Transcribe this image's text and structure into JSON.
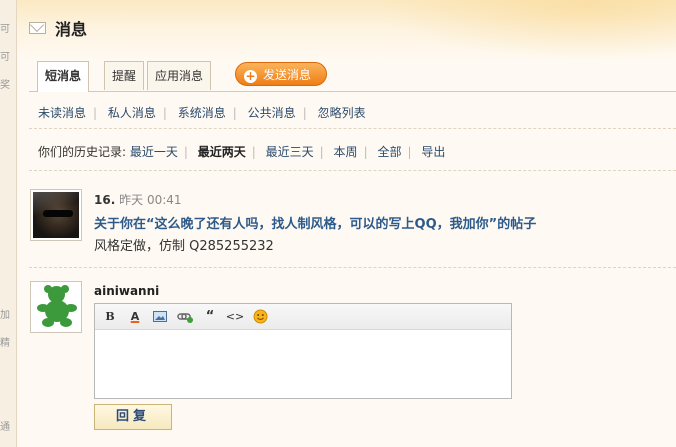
{
  "sidebar_fragments": [
    "可",
    "可",
    "奖",
    "加",
    "精",
    "通"
  ],
  "page": {
    "title": "消息"
  },
  "tabs": [
    {
      "label": "短消息",
      "active": true
    },
    {
      "label": "提醒",
      "active": false
    },
    {
      "label": "应用消息",
      "active": false
    }
  ],
  "send_button": {
    "label": "发送消息"
  },
  "subnav": [
    "未读消息",
    "私人消息",
    "系统消息",
    "公共消息",
    "忽略列表"
  ],
  "history": {
    "prefix": "你们的历史记录:",
    "options": [
      "最近一天",
      "最近两天",
      "最近三天",
      "本周",
      "全部",
      "导出"
    ],
    "current": "最近两天"
  },
  "message": {
    "number": "16.",
    "day": "昨天",
    "time": "00:41",
    "subject": "关于你在“这么晚了还有人吗，找人制风格，可以的写上QQ，我加你”的帖子",
    "body": "风格定做，仿制 Q285255232"
  },
  "reply": {
    "username": "ainiwanni",
    "button_label": "回复"
  },
  "toolbar": [
    "B",
    "A",
    "",
    "",
    "“",
    "<>",
    ""
  ],
  "colors": {
    "accent_orange": "#ef7d15",
    "link_blue": "#2b4a6c",
    "subject_blue": "#2d5a8a"
  }
}
